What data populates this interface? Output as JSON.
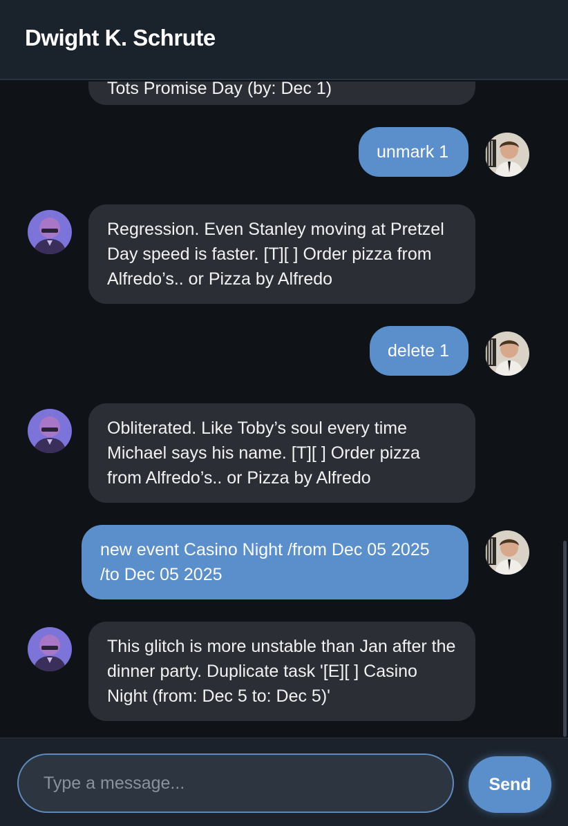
{
  "header": {
    "title": "Dwight K. Schrute"
  },
  "messages": [
    {
      "sender": "bot",
      "text": "Tots Promise Day (by: Dec 1)"
    },
    {
      "sender": "user",
      "text": "unmark 1"
    },
    {
      "sender": "bot",
      "text": "Regression. Even Stanley moving at Pretzel Day speed is faster. [T][ ] Order pizza from Alfredo’s.. or Pizza by Alfredo"
    },
    {
      "sender": "user",
      "text": "delete 1"
    },
    {
      "sender": "bot",
      "text": "Obliterated. Like Toby’s soul every time Michael says his name. [T][ ] Order pizza from Alfredo’s.. or Pizza by Alfredo"
    },
    {
      "sender": "user",
      "text": "new event Casino Night /from Dec 05 2025 /to Dec 05 2025"
    },
    {
      "sender": "bot",
      "text": "This glitch is more unstable than Jan after the dinner party. Duplicate task '[E][ ] Casino Night (from: Dec 5 to: Dec 5)'"
    }
  ],
  "composer": {
    "placeholder": "Type a message...",
    "value": "",
    "send_label": "Send"
  },
  "colors": {
    "background": "#0f1318",
    "header": "#1a222c",
    "bot_bubble": "#2b2f35",
    "user_bubble": "#5a8fcb",
    "accent": "#5a8fcb"
  }
}
